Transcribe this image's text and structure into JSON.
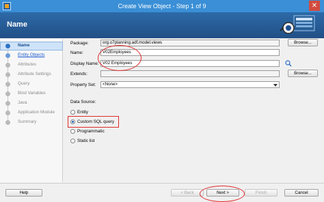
{
  "window": {
    "title": "Create View Object - Step 1 of 9",
    "close_glyph": "✕"
  },
  "header": {
    "title": "Name"
  },
  "sidebar": {
    "items": [
      {
        "label": "Name",
        "state": "active"
      },
      {
        "label": "Entity Objects",
        "state": "link"
      },
      {
        "label": "Attributes",
        "state": "disabled"
      },
      {
        "label": "Attribute Settings",
        "state": "disabled"
      },
      {
        "label": "Query",
        "state": "disabled"
      },
      {
        "label": "Bind Variables",
        "state": "disabled"
      },
      {
        "label": "Java",
        "state": "disabled"
      },
      {
        "label": "Application Module",
        "state": "disabled"
      },
      {
        "label": "Summary",
        "state": "disabled"
      }
    ]
  },
  "form": {
    "package_label": "Package:",
    "package_value": "org.o7planning.adf.model.views",
    "name_label": "Name:",
    "name_value": "V02Employees",
    "display_name_label": "Display Name:",
    "display_name_value": "V02 Employees",
    "extends_label": "Extends:",
    "extends_value": "",
    "property_set_label": "Property Set:",
    "property_set_value": "<None>",
    "browse_label": "Browse..."
  },
  "datasource": {
    "title": "Data Source:",
    "options": [
      {
        "label": "Entity",
        "checked": false
      },
      {
        "label": "Custom SQL query",
        "checked": true
      },
      {
        "label": "Programmatic",
        "checked": false
      },
      {
        "label": "Static list",
        "checked": false
      }
    ]
  },
  "footer": {
    "help": "Help",
    "back": "< Back",
    "next": "Next >",
    "finish": "Finish",
    "cancel": "Cancel"
  },
  "icons": {
    "app": "app-icon",
    "search": "search-icon",
    "header_graphic": "view-object-graphic"
  },
  "colors": {
    "titlebar": "#3a8fd6",
    "header": "#214f86",
    "annotation": "#e02a2a",
    "active_step": "#cfe3f8"
  }
}
